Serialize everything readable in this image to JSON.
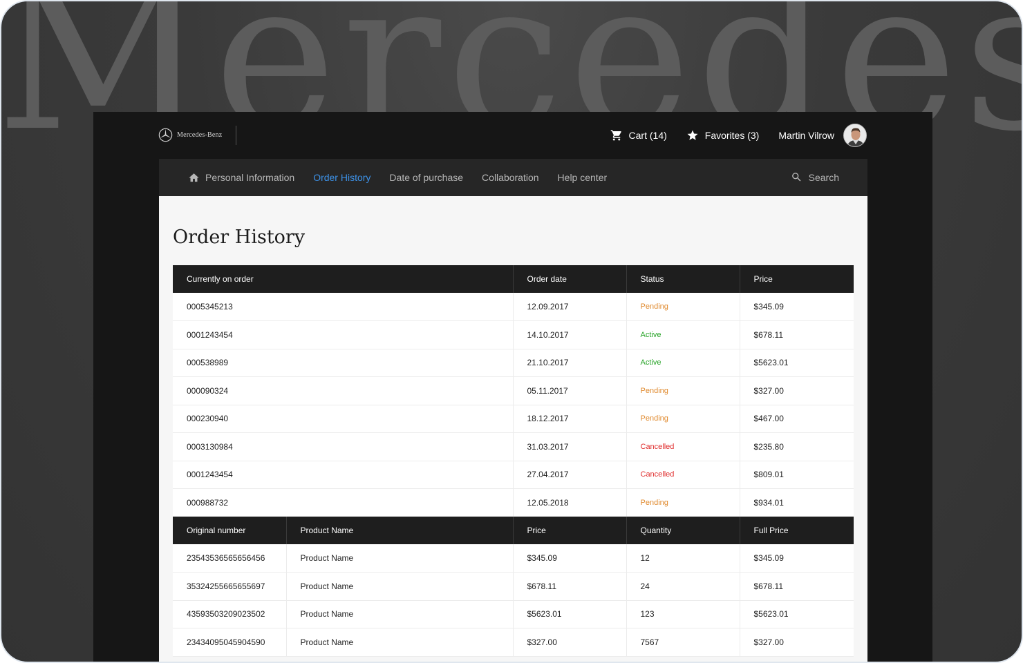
{
  "watermark": "Mercedes-B",
  "brand": {
    "logo_text": "Mercedes-Benz"
  },
  "topbar": {
    "cart_label": "Cart (14)",
    "favorites_label": "Favorites (3)",
    "user_name": "Martin Vilrow"
  },
  "nav": {
    "items": [
      {
        "label": "Personal Information",
        "icon": "home-icon"
      },
      {
        "label": "Order History"
      },
      {
        "label": "Date of purchase"
      },
      {
        "label": "Collaboration"
      },
      {
        "label": "Help center"
      }
    ],
    "active_index": 1,
    "search_label": "Search"
  },
  "page": {
    "title": "Order History"
  },
  "orders_table": {
    "headers": [
      "Currently on order",
      "Order date",
      "Status",
      "Price"
    ],
    "rows": [
      {
        "id": "0005345213",
        "date": "12.09.2017",
        "status": "Pending",
        "price": "$345.09"
      },
      {
        "id": "0001243454",
        "date": "14.10.2017",
        "status": "Active",
        "price": "$678.11"
      },
      {
        "id": "000538989",
        "date": "21.10.2017",
        "status": "Active",
        "price": "$5623.01"
      },
      {
        "id": "000090324",
        "date": "05.11.2017",
        "status": "Pending",
        "price": "$327.00"
      },
      {
        "id": "000230940",
        "date": "18.12.2017",
        "status": "Pending",
        "price": "$467.00"
      },
      {
        "id": "0003130984",
        "date": "31.03.2017",
        "status": "Cancelled",
        "price": "$235.80"
      },
      {
        "id": "0001243454",
        "date": "27.04.2017",
        "status": "Cancelled",
        "price": "$809.01"
      },
      {
        "id": "000988732",
        "date": "12.05.2018",
        "status": "Pending",
        "price": "$934.01"
      }
    ]
  },
  "items_table": {
    "headers": [
      "Original number",
      "Product Name",
      "Price",
      "Quantity",
      "Full Price"
    ],
    "rows": [
      {
        "number": "23543536565656456",
        "name": "Product Name",
        "price": "$345.09",
        "qty": "12",
        "full": "$345.09"
      },
      {
        "number": "35324255665655697",
        "name": "Product Name",
        "price": "$678.11",
        "qty": "24",
        "full": "$678.11"
      },
      {
        "number": "43593503209023502",
        "name": "Product Name",
        "price": "$5623.01",
        "qty": "123",
        "full": "$5623.01"
      },
      {
        "number": "23434095045904590",
        "name": "Product Name",
        "price": "$327.00",
        "qty": "7567",
        "full": "$327.00"
      }
    ]
  },
  "colors": {
    "pending": "#e08a2e",
    "active": "#27a327",
    "cancelled": "#e02d2d",
    "nav_active": "#3d92e8"
  }
}
